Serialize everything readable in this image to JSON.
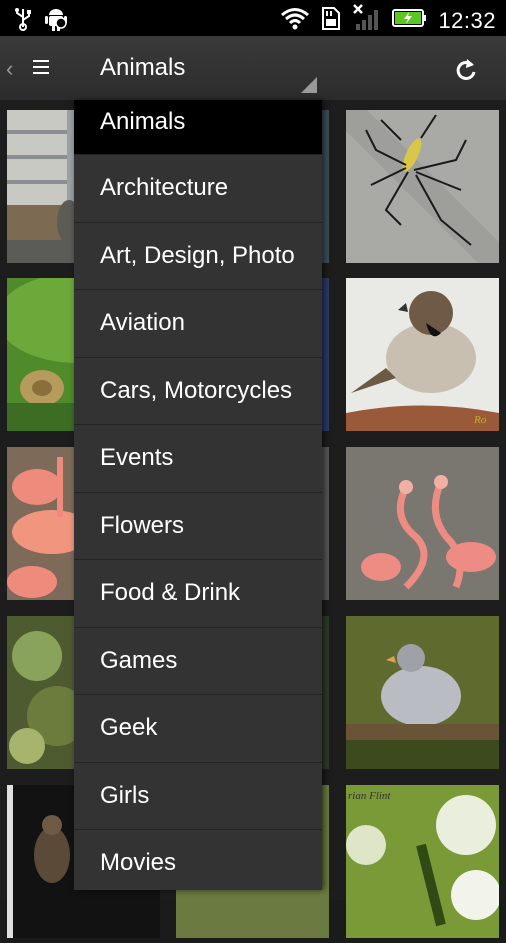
{
  "status_bar": {
    "time": "12:32",
    "icons": [
      "usb-icon",
      "android-debug-icon",
      "wifi-icon",
      "sd-card-icon",
      "no-signal-icon",
      "battery-charging-icon"
    ]
  },
  "action_bar": {
    "title": "Animals",
    "icons": [
      "back-chevron-icon",
      "menu-icon",
      "dropdown-indicator-icon",
      "refresh-icon"
    ]
  },
  "dropdown": {
    "items": [
      {
        "label": "Animals",
        "selected": true
      },
      {
        "label": "Architecture"
      },
      {
        "label": "Art, Design, Photo"
      },
      {
        "label": "Aviation"
      },
      {
        "label": "Cars, Motorcycles"
      },
      {
        "label": "Events"
      },
      {
        "label": "Flowers"
      },
      {
        "label": "Food & Drink"
      },
      {
        "label": "Games"
      },
      {
        "label": "Geek"
      },
      {
        "label": "Girls"
      },
      {
        "label": "Movies"
      }
    ]
  },
  "grid": {
    "photos": [
      "street-canal-photo",
      "spider-photo",
      "snail-photo",
      "sparrow-photo",
      "flamingos-photo",
      "flamingos-water-photo",
      "plant-photo",
      "pigeon-photo",
      "insect-dark-photo",
      "grasshopper-flowers-photo"
    ],
    "caption_fragments": {
      "sparrow": "Ro",
      "grasshopper": "rian Flint"
    }
  },
  "colors": {
    "action_bar": "#2c2c2c",
    "dropdown": "#333333",
    "selected_item": "#000000",
    "status_bar": "#000000"
  }
}
